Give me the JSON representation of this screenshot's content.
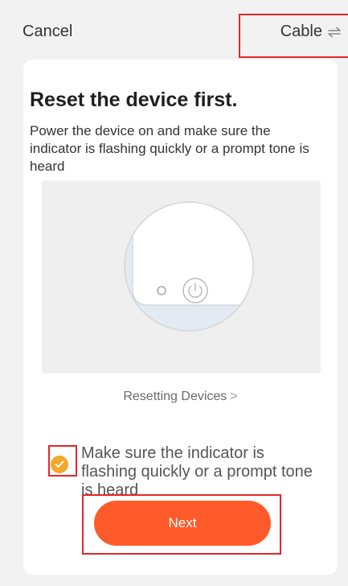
{
  "header": {
    "cancel_label": "Cancel",
    "mode_label": "Cable",
    "mode_icon": "swap-arrows-icon"
  },
  "card": {
    "title": "Reset the device first.",
    "description": "Power the device on and make sure the indicator is flashing quickly or a prompt tone is heard",
    "illustration_icon": "power-icon",
    "reset_link_label": "Resetting Devices",
    "reset_link_icon": "chevron-right-icon",
    "confirm_checked": true,
    "confirm_text": "Make sure the indicator is flashing quickly or a prompt tone is heard",
    "next_label": "Next"
  },
  "colors": {
    "accent": "#ff5a2a",
    "check": "#f4a92a",
    "highlight": "#e5262b",
    "background": "#f2f2f2",
    "card": "#ffffff"
  }
}
